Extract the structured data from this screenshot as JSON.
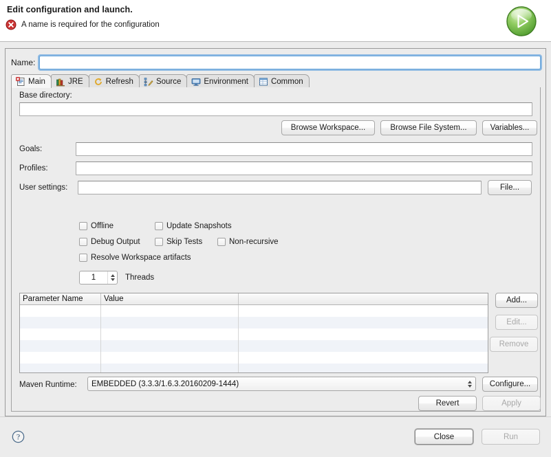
{
  "header": {
    "title": "Edit configuration and launch.",
    "error_message": "A name is required for the configuration",
    "error_icon": "error-circle-x-icon",
    "run_icon": "run-play-green-icon",
    "error_color": "#cc2222",
    "run_color": "#5aa832"
  },
  "name_row": {
    "label": "Name:",
    "value": "",
    "placeholder": ""
  },
  "tabs": [
    {
      "label": "Main",
      "icon": "main-document-error-icon",
      "active": true
    },
    {
      "label": "JRE",
      "icon": "jre-books-icon",
      "active": false
    },
    {
      "label": "Refresh",
      "icon": "refresh-arrows-icon",
      "active": false
    },
    {
      "label": "Source",
      "icon": "source-tree-pencil-icon",
      "active": false
    },
    {
      "label": "Environment",
      "icon": "environment-monitor-icon",
      "active": false
    },
    {
      "label": "Common",
      "icon": "common-window-icon",
      "active": false
    }
  ],
  "main_tab": {
    "base_directory": {
      "label": "Base directory:",
      "value": "",
      "buttons": [
        {
          "label": "Browse Workspace...",
          "name": "browse-workspace-button",
          "disabled": false
        },
        {
          "label": "Browse File System...",
          "name": "browse-file-system-button",
          "disabled": false
        },
        {
          "label": "Variables...",
          "name": "variables-button",
          "disabled": false
        }
      ]
    },
    "fields": [
      {
        "label": "Goals:",
        "value": "",
        "name": "goals"
      },
      {
        "label": "Profiles:",
        "value": "",
        "name": "profiles"
      },
      {
        "label": "User settings:",
        "value": "",
        "name": "user-settings"
      }
    ],
    "user_settings_button": {
      "label": "File...",
      "name": "user-settings-file-button"
    },
    "checkboxes": [
      {
        "label": "Offline",
        "checked": false,
        "name": "offline"
      },
      {
        "label": "Update Snapshots",
        "checked": false,
        "name": "update-snapshots"
      },
      {
        "label": "Debug Output",
        "checked": false,
        "name": "debug-output"
      },
      {
        "label": "Skip Tests",
        "checked": false,
        "name": "skip-tests"
      },
      {
        "label": "Non-recursive",
        "checked": false,
        "name": "non-recursive"
      },
      {
        "label": "Resolve Workspace artifacts",
        "checked": false,
        "name": "resolve-workspace-artifacts"
      }
    ],
    "threads": {
      "value": "1",
      "label": "Threads"
    },
    "parameters_table": {
      "columns": [
        "Parameter Name",
        "Value",
        ""
      ],
      "rows": [],
      "empty_row_count": 6,
      "buttons": [
        {
          "label": "Add...",
          "name": "add-parameter-button",
          "disabled": false
        },
        {
          "label": "Edit...",
          "name": "edit-parameter-button",
          "disabled": true
        },
        {
          "label": "Remove",
          "name": "remove-parameter-button",
          "disabled": true
        }
      ]
    },
    "maven_runtime": {
      "label": "Maven Runtime:",
      "value": "EMBEDDED (3.3.3/1.6.3.20160209-1444)",
      "configure_button": {
        "label": "Configure...",
        "name": "configure-maven-runtime-button"
      }
    }
  },
  "panel_actions": [
    {
      "label": "Revert",
      "name": "revert-button",
      "disabled": false
    },
    {
      "label": "Apply",
      "name": "apply-button",
      "disabled": true
    }
  ],
  "footer": {
    "help_icon": "help-question-icon",
    "buttons": [
      {
        "label": "Close",
        "name": "close-button",
        "disabled": false,
        "default": true
      },
      {
        "label": "Run",
        "name": "run-button",
        "disabled": true,
        "default": false
      }
    ]
  }
}
